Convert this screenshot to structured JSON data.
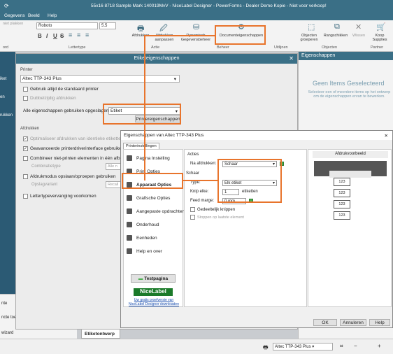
{
  "window": {
    "title": "55x16 8718 Sample Mark 140019MvV - NiceLabel Designer - PowerForms - Dealer Demo Kopie - Niet voor verkoop!"
  },
  "menu": [
    "Gegevens",
    "Beeld",
    "Help"
  ],
  "ribbon": {
    "font_name": "Roboto",
    "font_size": "5.5",
    "groups": {
      "font": "Lettertype",
      "action": "Actie",
      "manage": "Beheer",
      "align": "Uitlijnen",
      "objects": "Objecten",
      "partner": "Partner"
    },
    "left_label": "niet plakken",
    "left_sub": "ord",
    "buttons": {
      "print": "Afdrukken",
      "print_custom": "Afdrukken aanpassen",
      "dynamic_data": "Dynamisch Gegevensbeheer",
      "document_props": "Documenteigenschappen",
      "objects_group": "Objecten groeperen",
      "order": "Rangschikken",
      "remove": "Wissen",
      "buy": "Koop Supplies"
    }
  },
  "left_pane": [
    "iket",
    "en",
    "rukken",
    "nte",
    "ncte toevoegen",
    "wizard"
  ],
  "label_props_dialog": {
    "title": "Etiketeigenschappen",
    "printer_section": "Printer",
    "printer_value": "Altec TTP-343 Plus",
    "default_printer": "Gebruik altijd de standaard printer",
    "duplex": "Dubbelzijdig afdrukken",
    "store_text": "Alle eigenschappen gebruiken opgeslagen in:",
    "store_value": "Etiket",
    "printer_props_button": "Printereigenschappen",
    "print_section": "Afdrukken",
    "optimize": "Optimaliseer afdrukken van identieke etiketten",
    "advanced": "Geavanceerde printerdriverinterface gebruiken",
    "combine": "Combineer niet-printen elementen in één afbeelding",
    "combine_sub": "Combinatietype",
    "combine_value": "Alle n",
    "store_mode": "Afdrukmodus opslaan/oproepen gebruiken",
    "store_sub": "Opslagvariant",
    "store_mode_value": "Recall",
    "font_replace": "Lettertypevervanging voorkomen"
  },
  "right_pane": {
    "title": "Eigenschappen",
    "empty": "Geen Items Geselecteerd",
    "hint": "Selecteer een of meerdere items op het ontwerp om de eigenschappen ervan te bewerken."
  },
  "driver_dialog": {
    "title": "Eigenschappen van Altec TTP-343 Plus",
    "tab": "Printerinstellingen",
    "nav": [
      "Pagina Instelling",
      "Print Opties",
      "Apparaat Opties",
      "Grafische Opties",
      "Aangepaste opdrachten",
      "Onderhoud",
      "Eenheden",
      "Help en over"
    ],
    "test_button": "Testpagina",
    "brand": "NiceLabel",
    "promo": "Uw gratis proefversie van NiceLabel Designer downloaden",
    "actions_head": "Acties",
    "after_print": "Na afdrukken:",
    "after_print_value": "Schaar",
    "cutter_head": "Schaar",
    "type": "Type:",
    "type_value": "Elk etiket",
    "cut_each": "Knip elke:",
    "cut_each_value": "1",
    "cut_each_unit": "etiketten",
    "feed_margin": "Feed marge:",
    "feed_margin_value": "0 mm",
    "partial": "Gedeeltelijk knippen",
    "stop_last": "Stoppen op laatste element",
    "preview_head": "Afdrukvoorbeeld",
    "preview_labels": [
      "123",
      "123",
      "123",
      "123"
    ],
    "ok": "OK",
    "cancel": "Annuleren",
    "help": "Help"
  },
  "status": {
    "printer": "Altec TTP-343 Plus",
    "tab_design": "Etiketontwerp"
  }
}
